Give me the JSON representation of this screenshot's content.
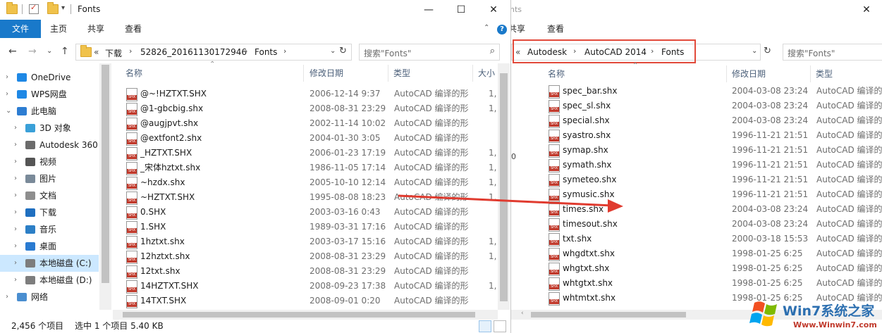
{
  "left_window": {
    "title": "Fonts",
    "window_buttons": {
      "minimize": "—",
      "maximize": "☐",
      "close": "✕"
    },
    "ribbon_tabs": [
      "文件",
      "主页",
      "共享",
      "查看"
    ],
    "help": "?",
    "breadcrumb": {
      "overflow": "«",
      "items": [
        "下载",
        "52826_20161130172946",
        "Fonts"
      ]
    },
    "search_placeholder": "搜索\"Fonts\"",
    "nav_pane": [
      {
        "label": "OneDrive",
        "expander": "›",
        "icon": "cloud-icon"
      },
      {
        "label": "WPS网盘",
        "expander": "›",
        "icon": "cloud-icon"
      },
      {
        "label": "此电脑",
        "expander": "⌄",
        "icon": "computer-icon"
      },
      {
        "label": "3D 对象",
        "expander": "›",
        "icon": "3d-objects-icon"
      },
      {
        "label": "Autodesk 360",
        "expander": "›",
        "icon": "autodesk-icon"
      },
      {
        "label": "视频",
        "expander": "›",
        "icon": "video-icon"
      },
      {
        "label": "图片",
        "expander": "›",
        "icon": "pictures-icon"
      },
      {
        "label": "文档",
        "expander": "›",
        "icon": "documents-icon"
      },
      {
        "label": "下载",
        "expander": "›",
        "icon": "download-icon"
      },
      {
        "label": "音乐",
        "expander": "›",
        "icon": "music-icon"
      },
      {
        "label": "桌面",
        "expander": "›",
        "icon": "desktop-icon"
      },
      {
        "label": "本地磁盘 (C:)",
        "expander": "›",
        "icon": "drive-icon",
        "selected": true
      },
      {
        "label": "本地磁盘 (D:)",
        "expander": "›",
        "icon": "drive-icon"
      },
      {
        "label": "网络",
        "expander": "›",
        "icon": "network-icon"
      }
    ],
    "columns": [
      "名称",
      "修改日期",
      "类型",
      "大小"
    ],
    "files": [
      {
        "name": "@~!HZTXT.SHX",
        "date": "2006-12-14 9:37",
        "type": "AutoCAD 编译的形",
        "size": "1,"
      },
      {
        "name": "@1-gbcbig.shx",
        "date": "2008-08-31 23:29",
        "type": "AutoCAD 编译的形",
        "size": "1,"
      },
      {
        "name": "@augjpvt.shx",
        "date": "2002-11-14 10:02",
        "type": "AutoCAD 编译的形",
        "size": ""
      },
      {
        "name": "@extfont2.shx",
        "date": "2004-01-30 3:05",
        "type": "AutoCAD 编译的形",
        "size": ""
      },
      {
        "name": "_HZTXT.SHX",
        "date": "2006-01-23 17:19",
        "type": "AutoCAD 编译的形",
        "size": "1,"
      },
      {
        "name": "_宋体hztxt.shx",
        "date": "1986-11-05 17:14",
        "type": "AutoCAD 编译的形",
        "size": "1,"
      },
      {
        "name": "~hzdx.shx",
        "date": "2005-10-10 12:14",
        "type": "AutoCAD 编译的形",
        "size": "1,"
      },
      {
        "name": "~HZTXT.SHX",
        "date": "1995-08-08 18:23",
        "type": "AutoCAD 编译的形",
        "size": "1,"
      },
      {
        "name": "0.SHX",
        "date": "2003-03-16 0:43",
        "type": "AutoCAD 编译的形",
        "size": ""
      },
      {
        "name": "1.SHX",
        "date": "1989-03-31 17:16",
        "type": "AutoCAD 编译的形",
        "size": ""
      },
      {
        "name": "1hztxt.shx",
        "date": "2003-03-17 15:16",
        "type": "AutoCAD 编译的形",
        "size": "1,"
      },
      {
        "name": "12hztxt.shx",
        "date": "2008-08-31 23:29",
        "type": "AutoCAD 编译的形",
        "size": "1,"
      },
      {
        "name": "12txt.shx",
        "date": "2008-08-31 23:29",
        "type": "AutoCAD 编译的形",
        "size": ""
      },
      {
        "name": "14HZTXT.SHX",
        "date": "2008-09-23 17:38",
        "type": "AutoCAD 编译的形",
        "size": "1,"
      },
      {
        "name": "14TXT.SHX",
        "date": "2008-09-01 0:20",
        "type": "AutoCAD 编译的形",
        "size": ""
      }
    ],
    "status": {
      "count": "2,456 个项目",
      "selection": "选中 1 个项目  5.40 KB"
    }
  },
  "right_window": {
    "title_fragment": "nts",
    "window_buttons": {
      "close": "✕"
    },
    "ribbon_tabs": [
      "共享",
      "查看"
    ],
    "breadcrumb": {
      "overflow": "«",
      "items": [
        "Autodesk",
        "AutoCAD 2014",
        "Fonts"
      ]
    },
    "search_placeholder": "搜索\"Fonts\"",
    "columns": [
      "名称",
      "修改日期",
      "类型"
    ],
    "files": [
      {
        "name": "spec_bar.shx",
        "date": "2004-03-08 23:24",
        "type": "AutoCAD 编译的"
      },
      {
        "name": "spec_sl.shx",
        "date": "2004-03-08 23:24",
        "type": "AutoCAD 编译的"
      },
      {
        "name": "special.shx",
        "date": "2004-03-08 23:24",
        "type": "AutoCAD 编译的"
      },
      {
        "name": "syastro.shx",
        "date": "1996-11-21 21:51",
        "type": "AutoCAD 编译的"
      },
      {
        "name": "symap.shx",
        "date": "1996-11-21 21:51",
        "type": "AutoCAD 编译的"
      },
      {
        "name": "symath.shx",
        "date": "1996-11-21 21:51",
        "type": "AutoCAD 编译的"
      },
      {
        "name": "symeteo.shx",
        "date": "1996-11-21 21:51",
        "type": "AutoCAD 编译的"
      },
      {
        "name": "symusic.shx",
        "date": "1996-11-21 21:51",
        "type": "AutoCAD 编译的"
      },
      {
        "name": "times.shx",
        "date": "2004-03-08 23:24",
        "type": "AutoCAD 编译的"
      },
      {
        "name": "timesout.shx",
        "date": "2004-03-08 23:24",
        "type": "AutoCAD 编译的"
      },
      {
        "name": "txt.shx",
        "date": "2000-03-18 15:53",
        "type": "AutoCAD 编译的"
      },
      {
        "name": "whgdtxt.shx",
        "date": "1998-01-25 6:25",
        "type": "AutoCAD 编译的"
      },
      {
        "name": "whgtxt.shx",
        "date": "1998-01-25 6:25",
        "type": "AutoCAD 编译的"
      },
      {
        "name": "whtgtxt.shx",
        "date": "1998-01-25 6:25",
        "type": "AutoCAD 编译的"
      },
      {
        "name": "whtmtxt.shx",
        "date": "1998-01-25 6:25",
        "type": "AutoCAD 编译的"
      }
    ],
    "edge_fragment": "0"
  },
  "watermark": {
    "brand": "Win7系统之家",
    "url": "Www.Winwin7.com"
  },
  "colors": {
    "accent": "#1979ca",
    "highlight": "#e24a3b",
    "selection": "#cce8ff"
  }
}
